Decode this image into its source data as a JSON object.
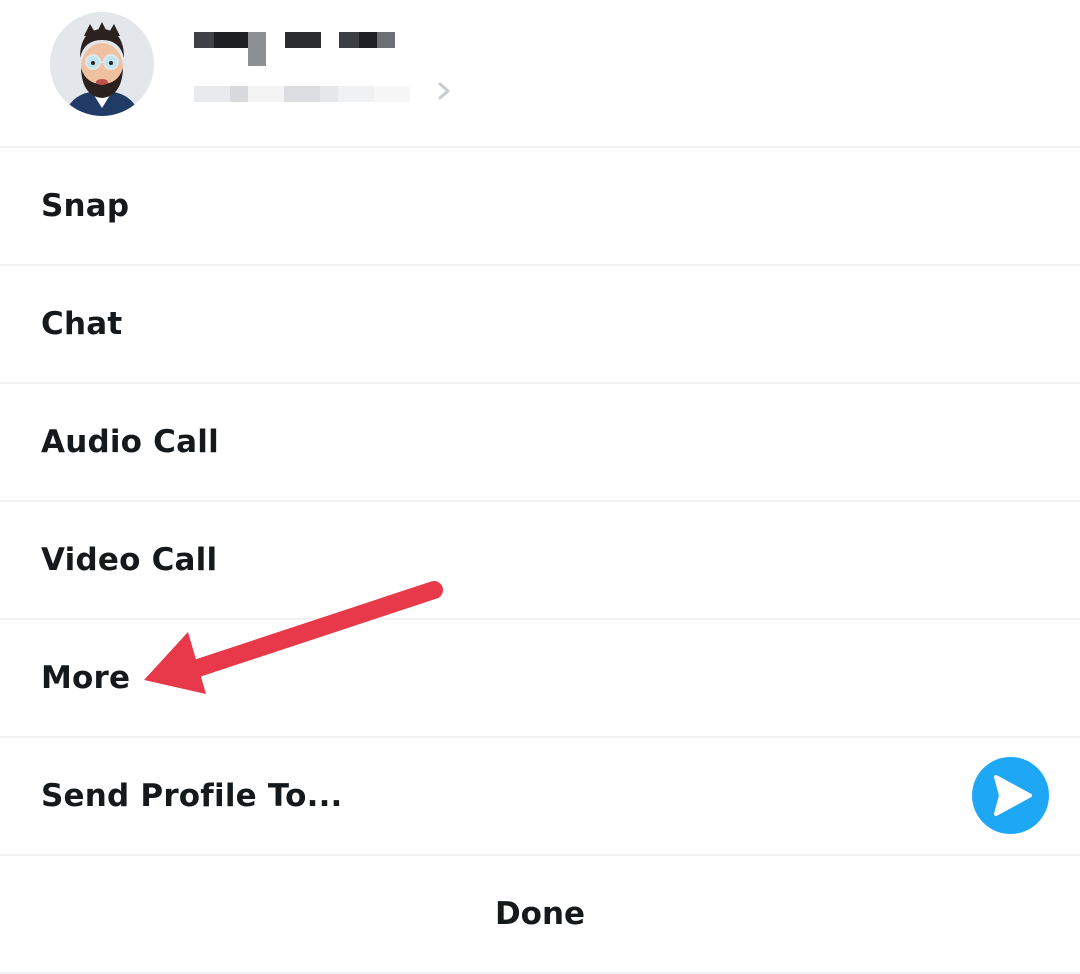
{
  "profile": {
    "avatar_icon": "bitmoji-avatar",
    "chevron_icon": "chevron-right-icon"
  },
  "menu": {
    "items": [
      {
        "label": "Snap"
      },
      {
        "label": "Chat"
      },
      {
        "label": "Audio Call"
      },
      {
        "label": "Video Call"
      },
      {
        "label": "More"
      },
      {
        "label": "Send Profile To..."
      }
    ],
    "done_label": "Done"
  },
  "send_icon": "send-arrow-icon",
  "annotation": {
    "type": "red-arrow",
    "points_to": "More",
    "color": "#e8394b"
  },
  "colors": {
    "send_button": "#1ea7f5",
    "divider": "#f1f2f4",
    "text": "#16191c"
  }
}
